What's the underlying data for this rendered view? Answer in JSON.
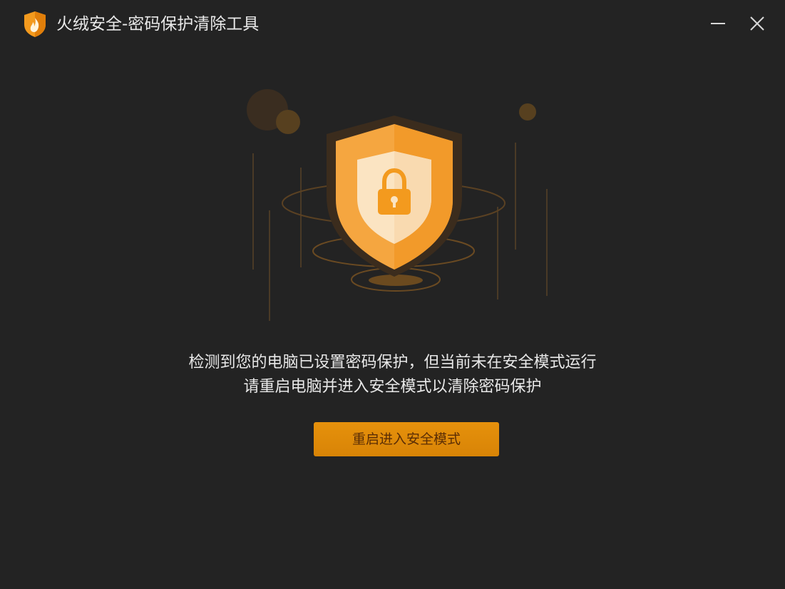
{
  "window": {
    "title": "火绒安全-密码保护清除工具",
    "controls": {
      "minimize_icon": "minimize-icon",
      "close_icon": "close-icon"
    }
  },
  "main": {
    "illustration_icon": "shield-lock-icon",
    "message_line1": "检测到您的电脑已设置密码保护，但当前未在安全模式运行",
    "message_line2": "请重启电脑并进入安全模式以清除密码保护",
    "action_button_label": "重启进入安全模式"
  },
  "colors": {
    "background": "#232323",
    "accent": "#e08a0a",
    "shield_outer": "#f5a640",
    "shield_inner": "#fbe4c2",
    "text": "#e8e8e8"
  }
}
